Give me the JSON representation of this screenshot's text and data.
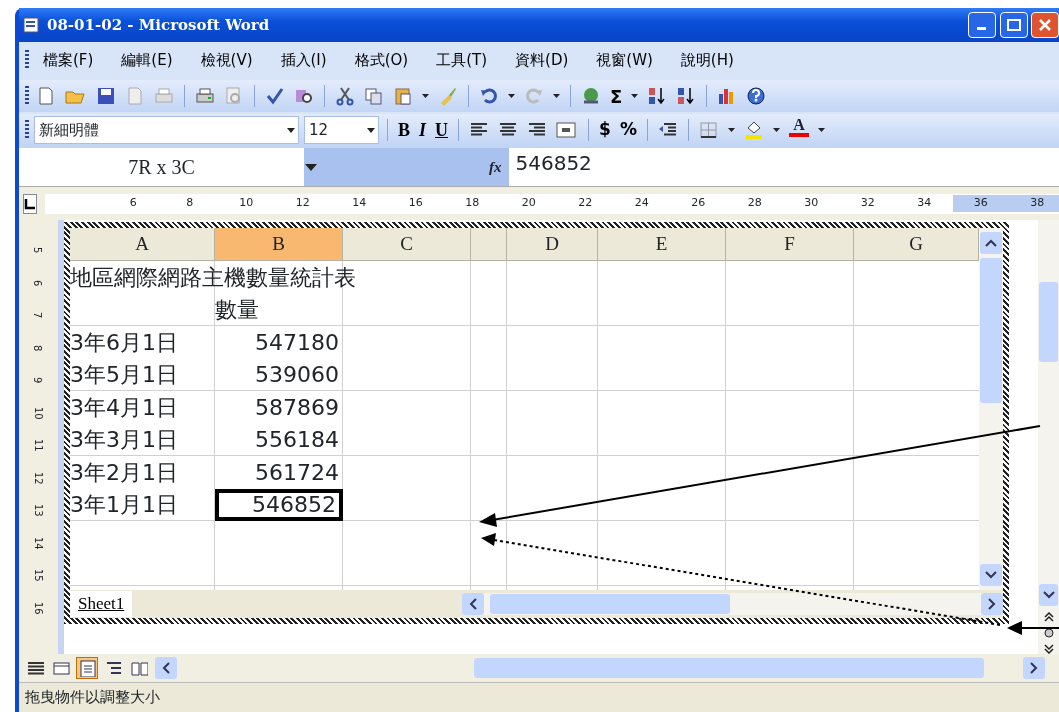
{
  "window": {
    "title": "08-01-02 - Microsoft Word"
  },
  "menu": [
    {
      "label": "檔案(F)"
    },
    {
      "label": "編輯(E)"
    },
    {
      "label": "檢視(V)"
    },
    {
      "label": "插入(I)"
    },
    {
      "label": "格式(O)"
    },
    {
      "label": "工具(T)"
    },
    {
      "label": "資料(D)"
    },
    {
      "label": "視窗(W)"
    },
    {
      "label": "說明(H)"
    }
  ],
  "standard_toolbar": {
    "sum_symbol": "Σ"
  },
  "formatting_toolbar": {
    "font": "新細明體",
    "size": "12",
    "bold": "B",
    "italic": "I",
    "underline": "U",
    "currency": "$",
    "percent": "%",
    "font_color": "A"
  },
  "formula_bar": {
    "name_box": "7R x 3C",
    "fx": "fx",
    "value": "546852"
  },
  "ruler": [
    {
      "label": "6",
      "margin": false
    },
    {
      "label": "8",
      "margin": false
    },
    {
      "label": "10",
      "margin": false
    },
    {
      "label": "12",
      "margin": false
    },
    {
      "label": "14",
      "margin": false
    },
    {
      "label": "16",
      "margin": false
    },
    {
      "label": "18",
      "margin": false
    },
    {
      "label": "20",
      "margin": false
    },
    {
      "label": "22",
      "margin": false
    },
    {
      "label": "24",
      "margin": false
    },
    {
      "label": "26",
      "margin": false
    },
    {
      "label": "28",
      "margin": false
    },
    {
      "label": "30",
      "margin": false
    },
    {
      "label": "32",
      "margin": false
    },
    {
      "label": "34",
      "margin": false
    },
    {
      "label": "36",
      "margin": true
    },
    {
      "label": "38",
      "margin": true
    }
  ],
  "vertical_ruler": [
    "5",
    "6",
    "7",
    "8",
    "9",
    "10",
    "11",
    "12",
    "13",
    "14",
    "15",
    "16"
  ],
  "sheet": {
    "columns": [
      {
        "label": "A",
        "selected": false
      },
      {
        "label": "B",
        "selected": true
      },
      {
        "label": "C",
        "selected": false
      },
      {
        "selected": false
      },
      {
        "label": "D",
        "selected": false
      },
      {
        "label": "E",
        "selected": false
      },
      {
        "label": "F",
        "selected": false
      },
      {
        "label": "G",
        "selected": false
      }
    ],
    "rows": [
      {
        "a": "地區網際網路主機數量統計表"
      },
      {
        "b": "數量",
        "selected": false
      },
      {
        "a": "3年6月1日",
        "b": "547180",
        "selected": false
      },
      {
        "a": "3年5月1日",
        "b": "539060",
        "selected": false
      },
      {
        "a": "3年4月1日",
        "b": "587869",
        "selected": false
      },
      {
        "a": "3年3月1日",
        "b": "556184",
        "selected": false
      },
      {
        "a": "3年2月1日",
        "b": "561724",
        "selected": false
      },
      {
        "a": "3年1月1日",
        "b": "546852",
        "selected": true
      }
    ],
    "tabs": [
      {
        "label": "Sheet1",
        "selected": true
      }
    ]
  },
  "view_buttons": [
    {
      "kind": "normal",
      "selected": false
    },
    {
      "kind": "web",
      "selected": false
    },
    {
      "kind": "print",
      "selected": true
    },
    {
      "kind": "outline",
      "selected": false
    },
    {
      "kind": "reading",
      "selected": false
    }
  ],
  "status_bar": "拖曳物件以調整大小"
}
